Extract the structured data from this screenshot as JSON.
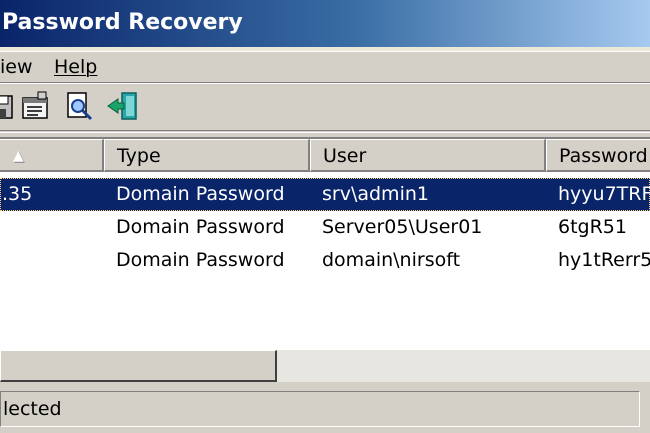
{
  "window": {
    "title": "Password Recovery"
  },
  "menu": [
    {
      "label": "iew"
    },
    {
      "label": "Help"
    }
  ],
  "toolbar": {
    "buttons": [
      {
        "icon": "save-icon"
      },
      {
        "icon": "properties-icon"
      },
      {
        "icon": "find-icon"
      },
      {
        "icon": "exit-icon"
      }
    ]
  },
  "table": {
    "columns": [
      "",
      "Type",
      "User",
      "Password"
    ],
    "rows": [
      {
        "item": ".35",
        "type": "Domain Password",
        "user": "srv\\admin1",
        "password": "hyyu7TRF"
      },
      {
        "item": "",
        "type": "Domain Password",
        "user": "Server05\\User01",
        "password": "6tgR51"
      },
      {
        "item": "",
        "type": "Domain Password",
        "user": "domain\\nirsoft",
        "password": "hy1tRerr5"
      }
    ],
    "sort_indicator": "▲"
  },
  "status": {
    "text": "lected"
  },
  "colors": {
    "selection": "#0a246a",
    "title_gradient_start": "#0a246a",
    "title_gradient_end": "#a6caf0",
    "face": "#d4d0c8"
  }
}
